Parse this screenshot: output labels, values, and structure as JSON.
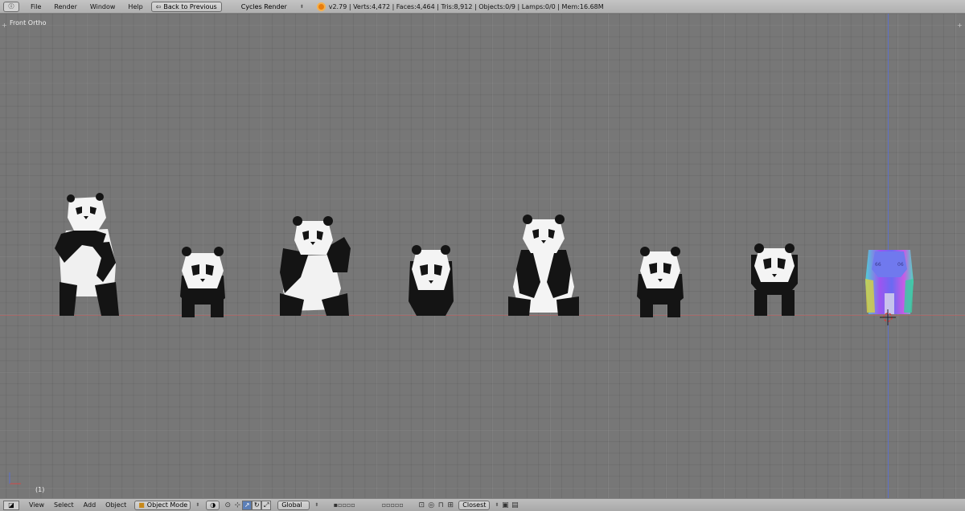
{
  "topbar": {
    "menus": [
      "File",
      "Render",
      "Window",
      "Help"
    ],
    "back_button": "Back to Previous",
    "render_engine": "Cycles Render",
    "stats": "v2.79 | Verts:4,472 | Faces:4,464 | Tris:8,912 | Objects:0/9 | Lamps:0/0 | Mem:16.68M"
  },
  "viewport": {
    "view_name": "Front Ortho",
    "frame": "(1)"
  },
  "bottombar": {
    "menus": [
      "View",
      "Select",
      "Add",
      "Object"
    ],
    "mode": "Object Mode",
    "orientation": "Global",
    "snap_target": "Closest"
  },
  "colors": {
    "viewport_bg": "#777777",
    "header_bg": "#b8b8b8",
    "x_axis": "#b06464",
    "z_axis": "#5a6fd0",
    "panda_black": "#141414",
    "panda_white": "#f4f4f4"
  }
}
